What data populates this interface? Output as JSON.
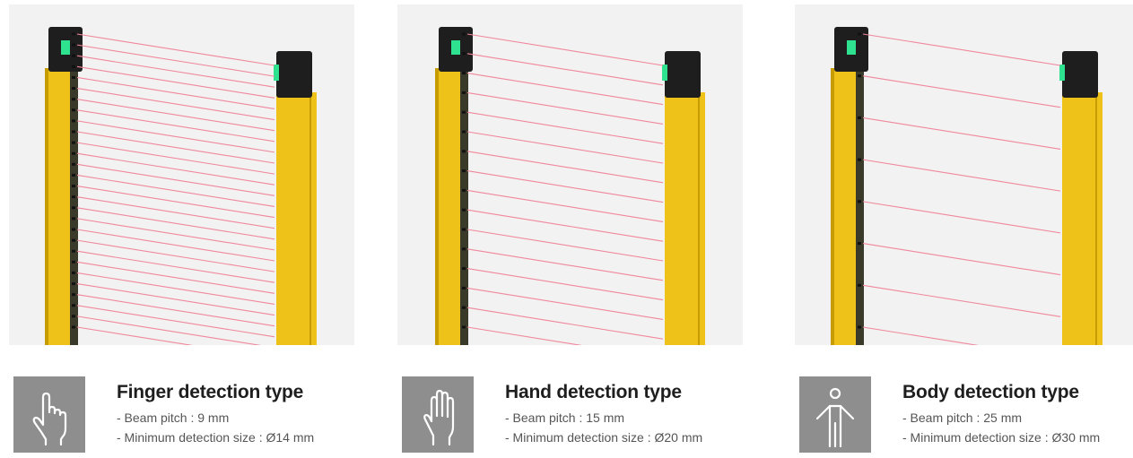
{
  "colors": {
    "image_background": "#f2f2f2",
    "housing_yellow": "#efc21a",
    "housing_yellow_dark": "#c79c00",
    "cap_black": "#1e1e1e",
    "indicator_green": "#2ee28f",
    "beam_red": "#f0879a",
    "icon_tile": "#8e8e8e",
    "title_text": "#1e1e1e",
    "spec_text": "#555555"
  },
  "products": [
    {
      "icon": "finger-point-icon",
      "title": "Finger detection type",
      "specs": [
        "- Beam pitch : 9 mm",
        "- Minimum detection size : Ø14 mm"
      ],
      "beam_count": 28
    },
    {
      "icon": "open-hand-icon",
      "title": "Hand detection type",
      "specs": [
        "- Beam pitch : 15 mm",
        "- Minimum detection size : Ø20 mm"
      ],
      "beam_count": 16
    },
    {
      "icon": "human-body-icon",
      "title": "Body detection type",
      "specs": [
        "- Beam pitch : 25 mm",
        "- Minimum detection size : Ø30 mm"
      ],
      "beam_count": 8
    }
  ]
}
